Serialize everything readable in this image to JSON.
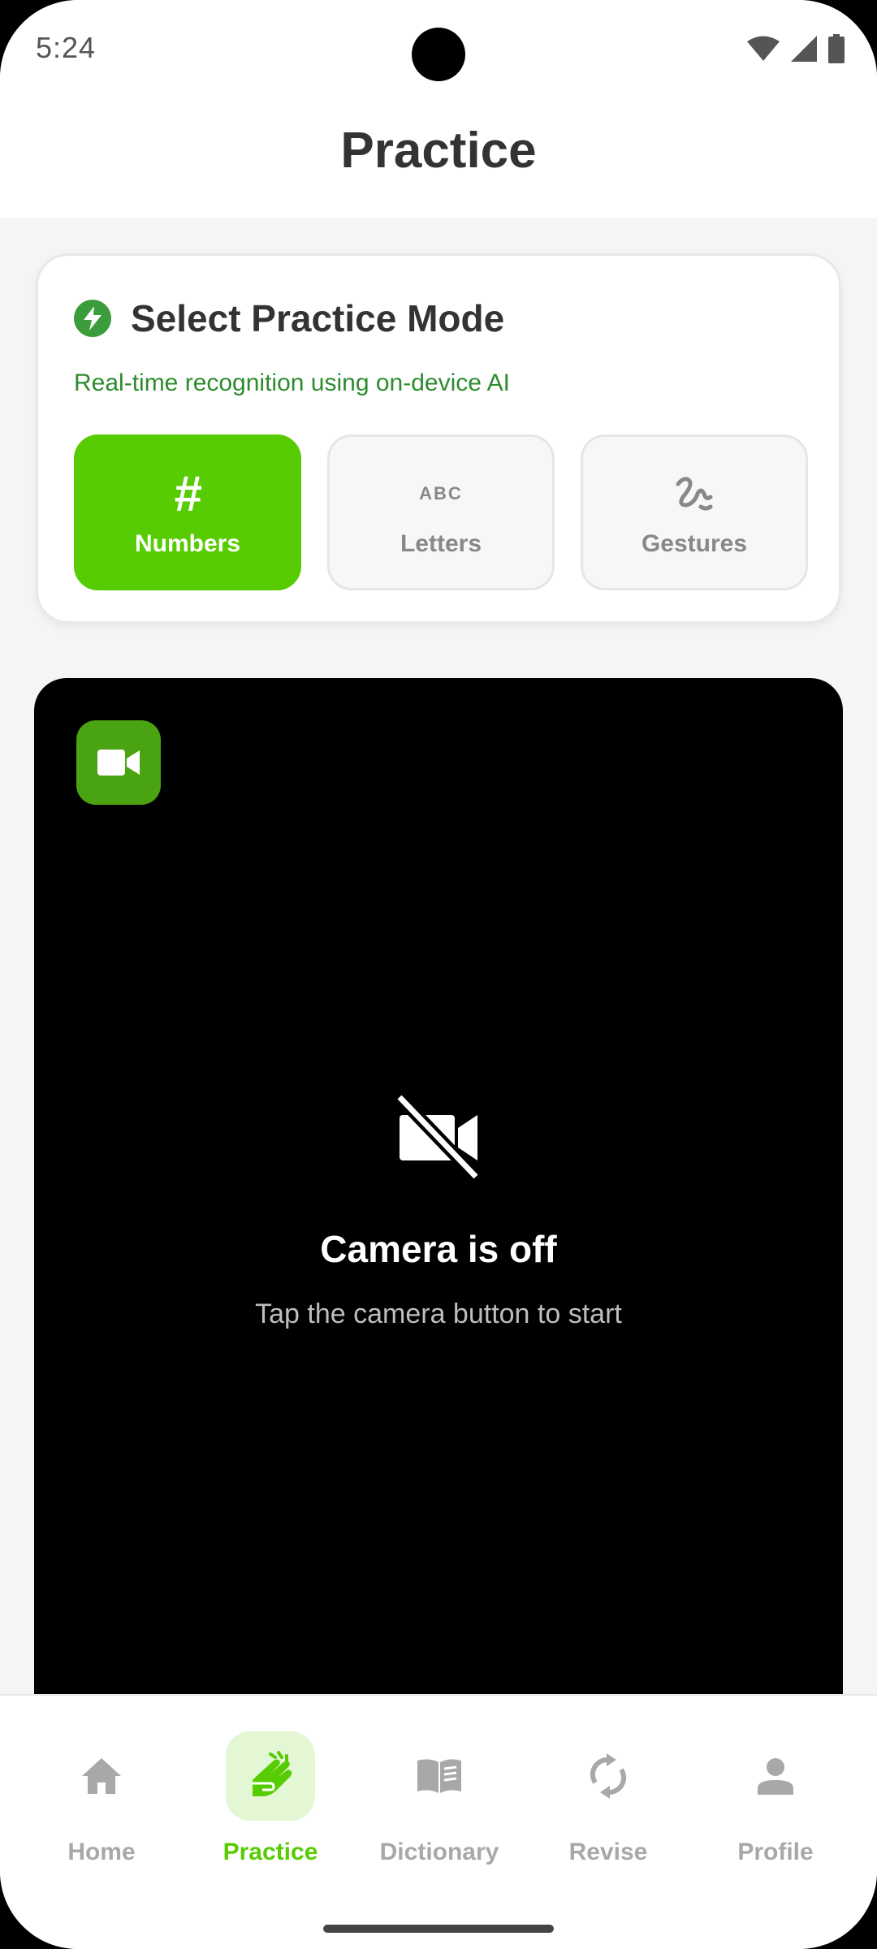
{
  "status_bar": {
    "time": "5:24"
  },
  "header": {
    "title": "Practice"
  },
  "mode_card": {
    "title": "Select Practice Mode",
    "subtitle": "Real-time recognition using on-device AI",
    "modes": [
      {
        "label": "Numbers",
        "icon": "hash-icon",
        "icon_text": "#",
        "active": true
      },
      {
        "label": "Letters",
        "icon": "abc-icon",
        "icon_text": "ABC",
        "active": false
      },
      {
        "label": "Gestures",
        "icon": "gesture-icon",
        "active": false
      }
    ]
  },
  "camera": {
    "title": "Camera is off",
    "hint": "Tap the camera button to start"
  },
  "bottom_nav": {
    "items": [
      {
        "label": "Home",
        "icon": "home-icon",
        "active": false
      },
      {
        "label": "Practice",
        "icon": "sign-language-icon",
        "active": true
      },
      {
        "label": "Dictionary",
        "icon": "book-icon",
        "active": false
      },
      {
        "label": "Revise",
        "icon": "sync-icon",
        "active": false
      },
      {
        "label": "Profile",
        "icon": "person-icon",
        "active": false
      }
    ]
  },
  "colors": {
    "accent": "#58cc02",
    "accent_dark": "#4aa310",
    "subtitle_green": "#2e8b2e",
    "inactive": "#a8a8a8"
  }
}
